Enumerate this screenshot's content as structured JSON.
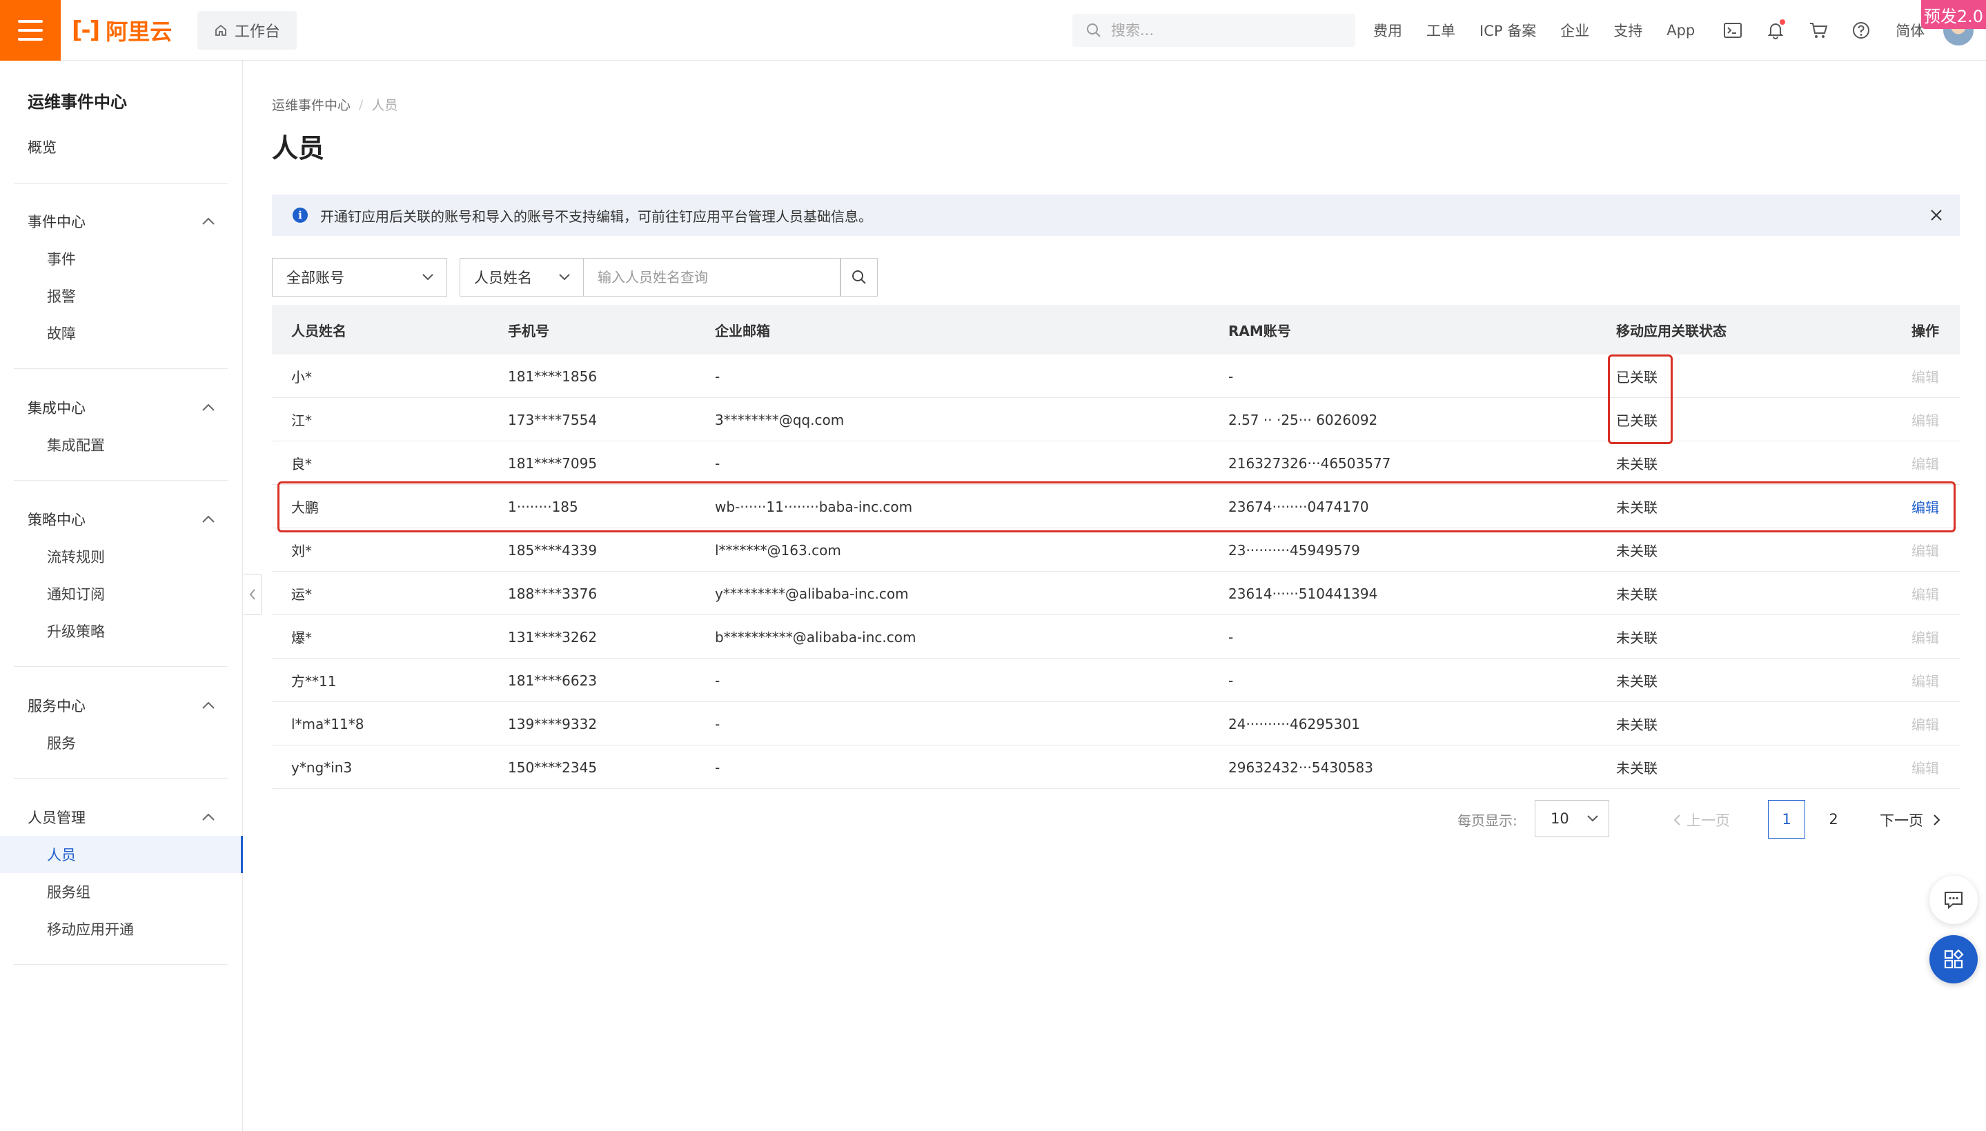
{
  "topbar": {
    "logo_mark": "[-]",
    "logo_text": "阿里云",
    "workbench": "工作台",
    "search_placeholder": "搜索...",
    "links": [
      "费用",
      "工单",
      "ICP 备案",
      "企业",
      "支持",
      "App"
    ],
    "lang": "简体",
    "badge": "预发2.0",
    "icons": [
      "terminal-icon",
      "bell-icon",
      "cart-icon",
      "help-icon"
    ]
  },
  "sidebar": {
    "title": "运维事件中心",
    "overview": "概览",
    "groups": [
      {
        "label": "事件中心",
        "items": [
          "事件",
          "报警",
          "故障"
        ]
      },
      {
        "label": "集成中心",
        "items": [
          "集成配置"
        ]
      },
      {
        "label": "策略中心",
        "items": [
          "流转规则",
          "通知订阅",
          "升级策略"
        ]
      },
      {
        "label": "服务中心",
        "items": [
          "服务"
        ]
      },
      {
        "label": "人员管理",
        "items": [
          "人员",
          "服务组",
          "移动应用开通"
        ]
      }
    ],
    "active": "人员"
  },
  "main": {
    "breadcrumb": [
      "运维事件中心",
      "人员"
    ],
    "title": "人员",
    "alert": "开通钉应用后关联的账号和导入的账号不支持编辑，可前往钉应用平台管理人员基础信息。",
    "filters": {
      "account_type": "全部账号",
      "field": "人员姓名",
      "placeholder": "输入人员姓名查询"
    },
    "columns": [
      "人员姓名",
      "手机号",
      "企业邮箱",
      "RAM账号",
      "移动应用关联状态",
      "操作"
    ],
    "rows": [
      {
        "name": "小*",
        "phone": "181****1856",
        "email": "-",
        "ram": "-",
        "status": "已关联",
        "action": "编辑"
      },
      {
        "name": "江*",
        "phone": "173****7554",
        "email": "3********@qq.com",
        "ram": "2.57 ·· ·25··· 6026092",
        "status": "已关联",
        "action": "编辑"
      },
      {
        "name": "良*",
        "phone": "181****7095",
        "email": "-",
        "ram": "216327326···46503577",
        "status": "未关联",
        "action": "编辑"
      },
      {
        "name": "大鹏",
        "phone": "1········185",
        "email": "wb-······11········baba-inc.com",
        "ram": "23674········0474170",
        "status": "未关联",
        "action": "编辑"
      },
      {
        "name": "刘*",
        "phone": "185****4339",
        "email": "l*******@163.com",
        "ram": "23··········45949579",
        "status": "未关联",
        "action": "编辑"
      },
      {
        "name": "运*",
        "phone": "188****3376",
        "email": "y*********@alibaba-inc.com",
        "ram": "23614······510441394",
        "status": "未关联",
        "action": "编辑"
      },
      {
        "name": "爆*",
        "phone": "131****3262",
        "email": "b**********@alibaba-inc.com",
        "ram": "-",
        "status": "未关联",
        "action": "编辑"
      },
      {
        "name": "方**11",
        "phone": "181****6623",
        "email": "-",
        "ram": "-",
        "status": "未关联",
        "action": "编辑"
      },
      {
        "name": "l*ma*11*8",
        "phone": "139****9332",
        "email": "-",
        "ram": "24··········46295301",
        "status": "未关联",
        "action": "编辑"
      },
      {
        "name": "y*ng*in3",
        "phone": "150****2345",
        "email": "-",
        "ram": "29632432···5430583",
        "status": "未关联",
        "action": "编辑"
      }
    ],
    "pagination": {
      "label": "每页显示:",
      "page_size": "10",
      "prev": "上一页",
      "pages": [
        "1",
        "2"
      ],
      "current": "1",
      "next": "下一页"
    }
  },
  "colors": {
    "brand": "#ff6a00",
    "primary": "#1f5fcc",
    "highlight_box": "#d93025",
    "badge": "#ee4f8b"
  }
}
